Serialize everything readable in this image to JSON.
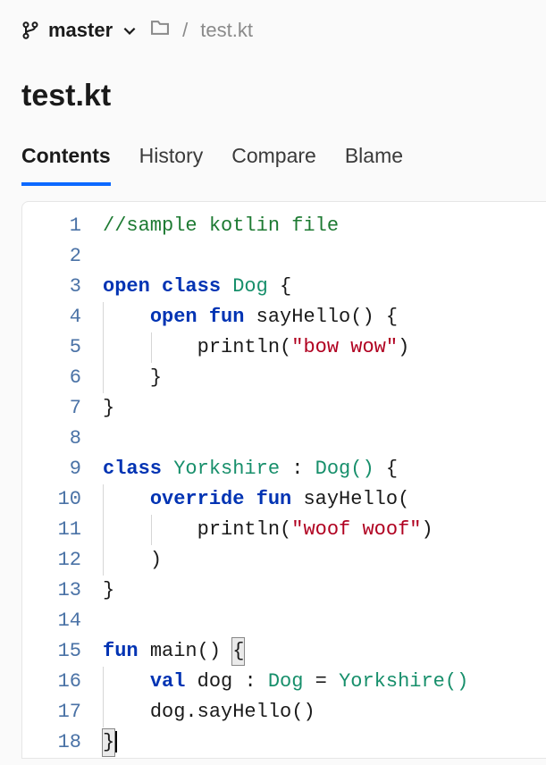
{
  "branch": "master",
  "breadcrumb_file": "test.kt",
  "page_title": "test.kt",
  "tabs": {
    "contents": "Contents",
    "history": "History",
    "compare": "Compare",
    "blame": "Blame"
  },
  "code": {
    "lines": [
      {
        "n": "1"
      },
      {
        "n": "2"
      },
      {
        "n": "3"
      },
      {
        "n": "4"
      },
      {
        "n": "5"
      },
      {
        "n": "6"
      },
      {
        "n": "7"
      },
      {
        "n": "8"
      },
      {
        "n": "9"
      },
      {
        "n": "10"
      },
      {
        "n": "11"
      },
      {
        "n": "12"
      },
      {
        "n": "13"
      },
      {
        "n": "14"
      },
      {
        "n": "15"
      },
      {
        "n": "16"
      },
      {
        "n": "17"
      },
      {
        "n": "18"
      }
    ],
    "t": {
      "comment1": "//sample kotlin file",
      "open": "open",
      "class": "class",
      "Dog": "Dog",
      "lbrace": "{",
      "rbrace": "}",
      "fun": "fun",
      "sayHello": "sayHello",
      "parens": "()",
      "println": "println",
      "lparen": "(",
      "rparen": ")",
      "str_bow": "\"bow wow\"",
      "Yorkshire": "Yorkshire",
      "colon": ":",
      "DogCall": "Dog()",
      "override": "override",
      "str_woof": "\"woof woof\"",
      "main": "main",
      "val": "val",
      "dog": "dog",
      "eq": "=",
      "YorkshireCall": "Yorkshire()",
      "dogSayHello": "dog.sayHello()"
    }
  }
}
